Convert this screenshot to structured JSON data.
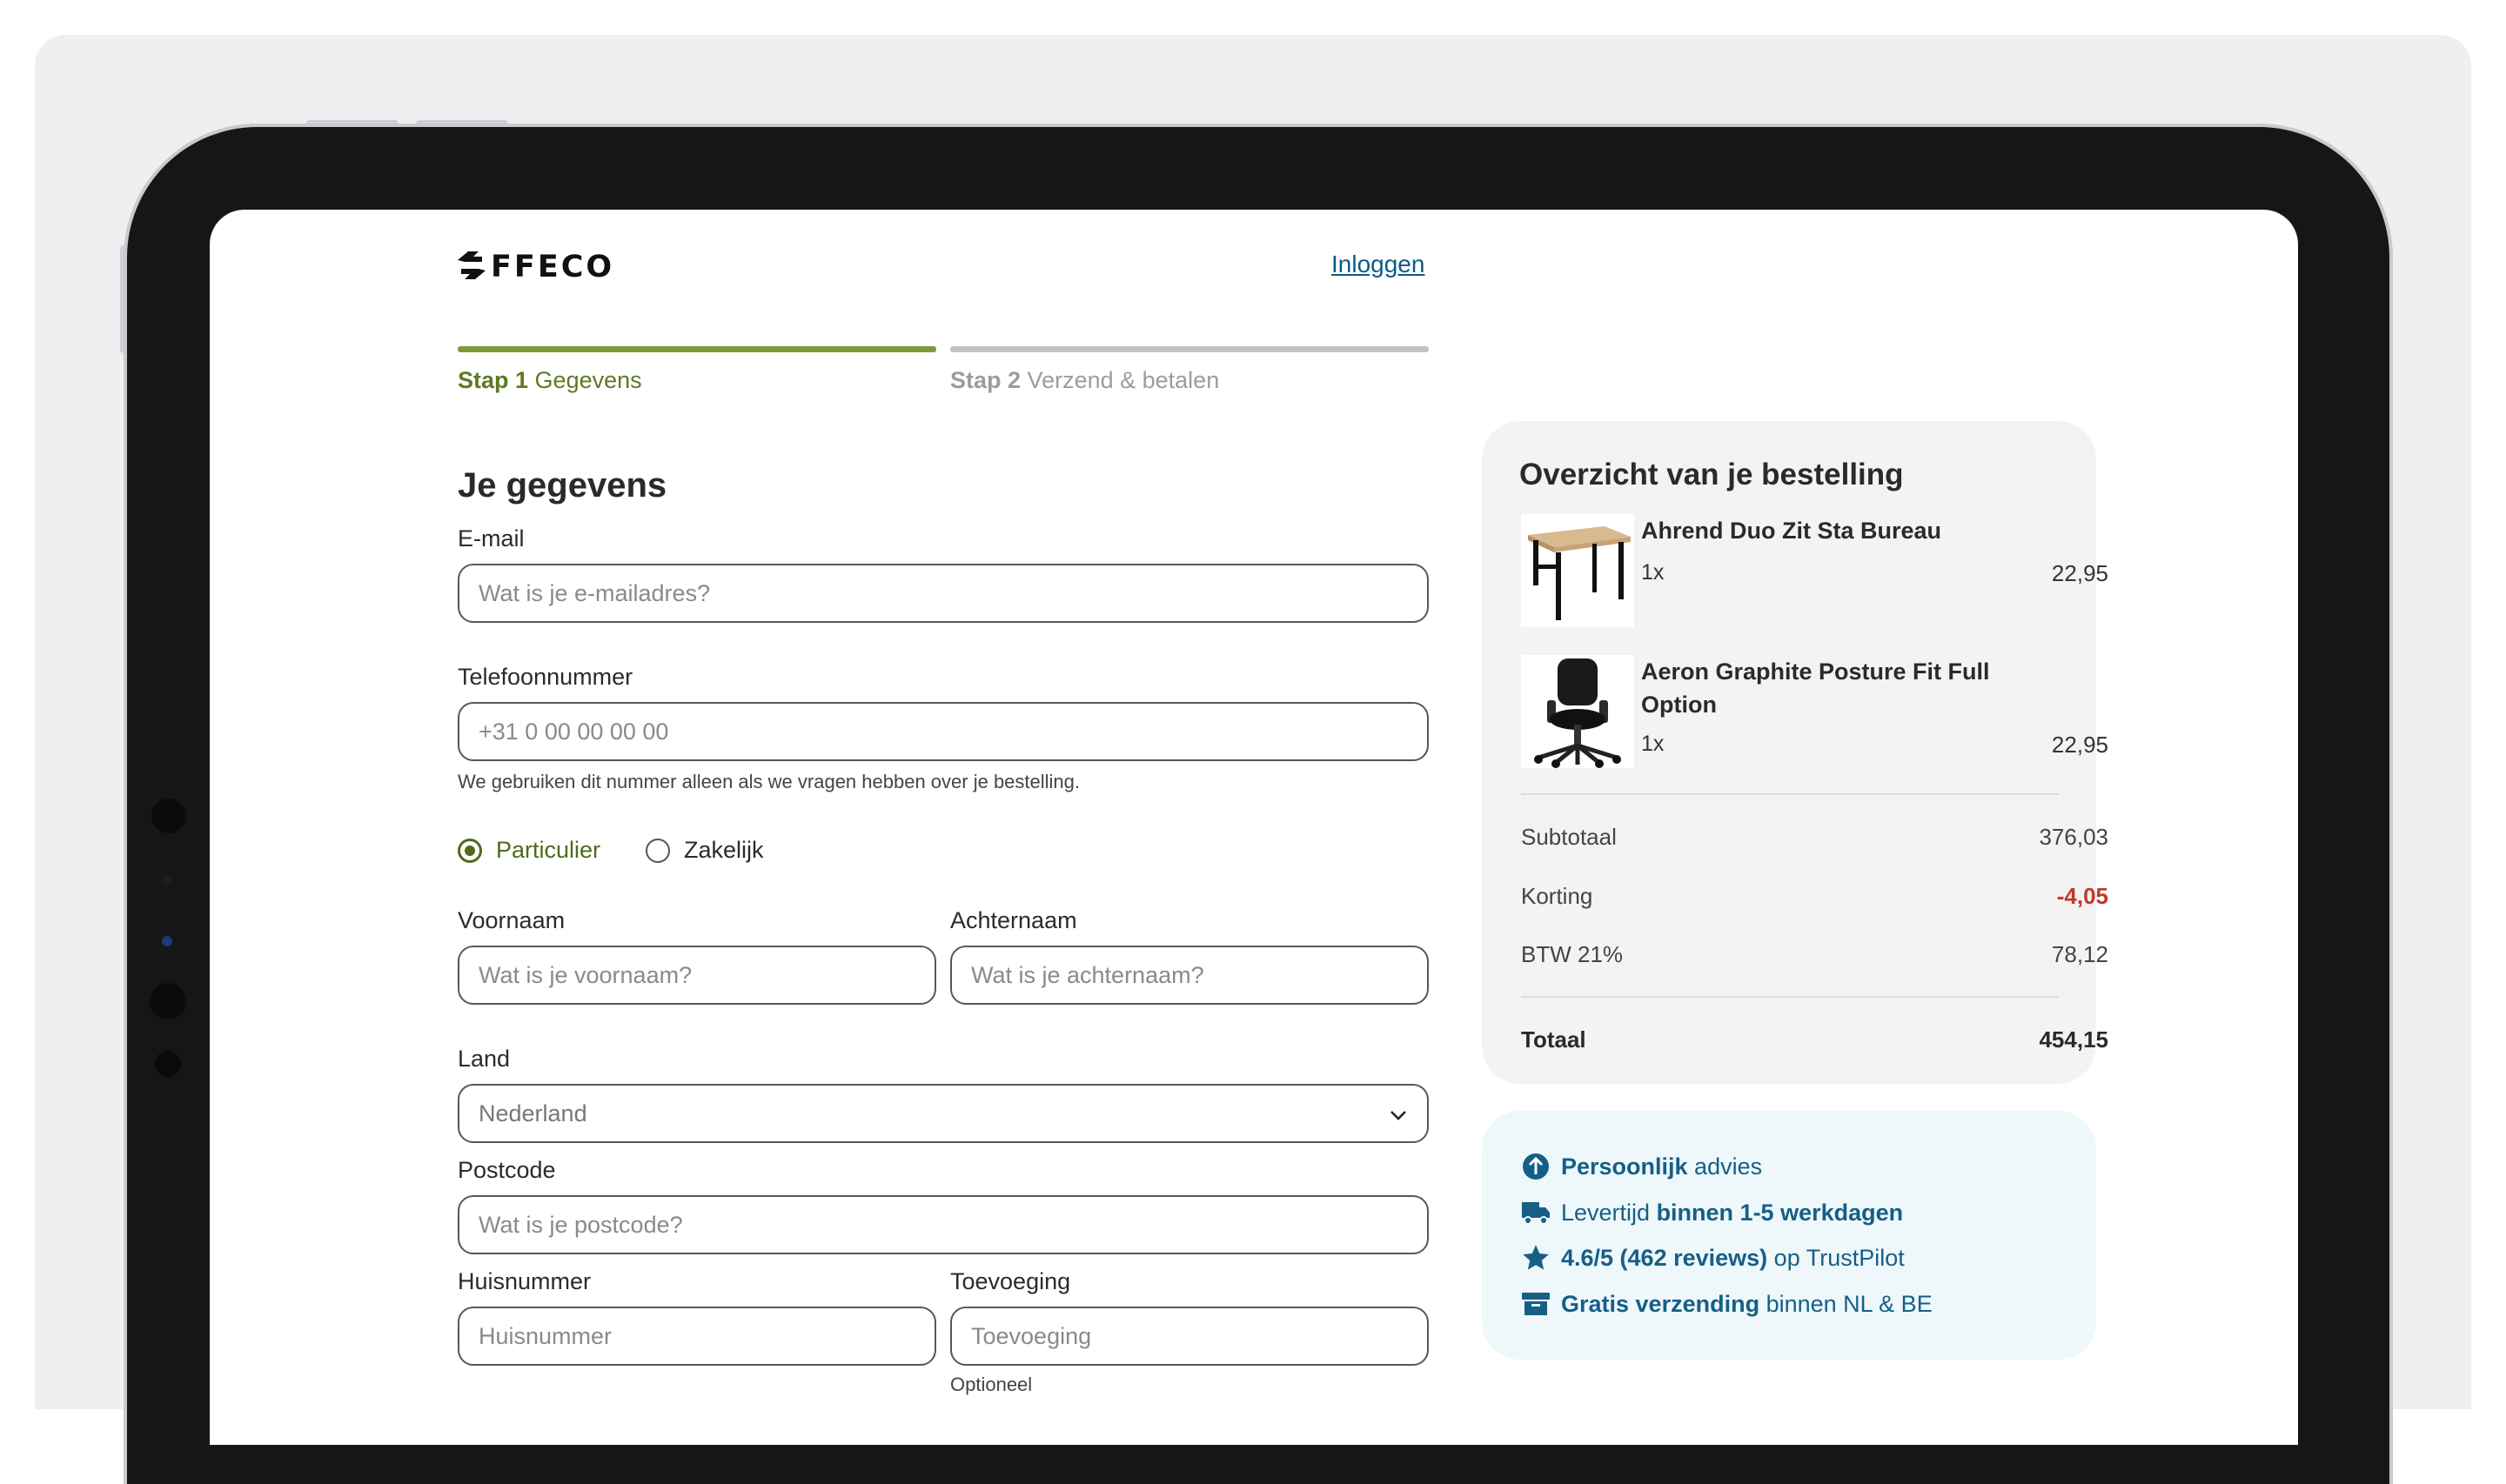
{
  "brand": {
    "logo_text": "FFECO"
  },
  "header": {
    "login_label": "Inloggen"
  },
  "steps": [
    {
      "number": "Stap 1",
      "label": "Gegevens",
      "active": true
    },
    {
      "number": "Stap 2",
      "label": "Verzend & betalen",
      "active": false
    }
  ],
  "form": {
    "title": "Je gegevens",
    "email": {
      "label": "E-mail",
      "placeholder": "Wat is je e-mailadres?"
    },
    "phone": {
      "label": "Telefoonnummer",
      "placeholder": "+31 0 00 00 00 00",
      "help": "We gebruiken dit nummer alleen als we vragen hebben over je bestelling."
    },
    "customer_type": {
      "options": [
        "Particulier",
        "Zakelijk"
      ],
      "selected": "Particulier"
    },
    "first_name": {
      "label": "Voornaam",
      "placeholder": "Wat is je voornaam?"
    },
    "last_name": {
      "label": "Achternaam",
      "placeholder": "Wat is je achternaam?"
    },
    "country": {
      "label": "Land",
      "value": "Nederland"
    },
    "postcode": {
      "label": "Postcode",
      "placeholder": "Wat is je postcode?"
    },
    "house_number": {
      "label": "Huisnummer",
      "placeholder": "Huisnummer"
    },
    "addition": {
      "label": "Toevoeging",
      "placeholder": "Toevoeging",
      "help": "Optioneel"
    }
  },
  "summary": {
    "title": "Overzicht van je bestelling",
    "items": [
      {
        "name": "Ahrend Duo Zit Sta Bureau",
        "qty": "1x",
        "price": "22,95"
      },
      {
        "name": "Aeron Graphite Posture Fit Full Option",
        "qty": "1x",
        "price": "22,95"
      }
    ],
    "subtotal": {
      "label": "Subtotaal",
      "value": "376,03"
    },
    "discount": {
      "label": "Korting",
      "value": "-4,05"
    },
    "vat": {
      "label": "BTW 21%",
      "value": "78,12"
    },
    "total": {
      "label": "Totaal",
      "value": "454,15"
    }
  },
  "benefits": [
    {
      "icon": "advice-icon",
      "bold": "Persoonlijk",
      "text": " advies"
    },
    {
      "icon": "truck-icon",
      "text": "Levertijd ",
      "bold": "binnen 1-5 werkdagen"
    },
    {
      "icon": "star-icon",
      "bold": "4.6/5 (462 reviews)",
      "text": " op TrustPilot"
    },
    {
      "icon": "box-icon",
      "bold": "Gratis verzending",
      "text": " binnen NL & BE"
    }
  ],
  "colors": {
    "accent_green": "#7d9a3a",
    "radio_green": "#4f6b1c",
    "link_blue": "#0d5a86",
    "discount_red": "#c0392b"
  }
}
